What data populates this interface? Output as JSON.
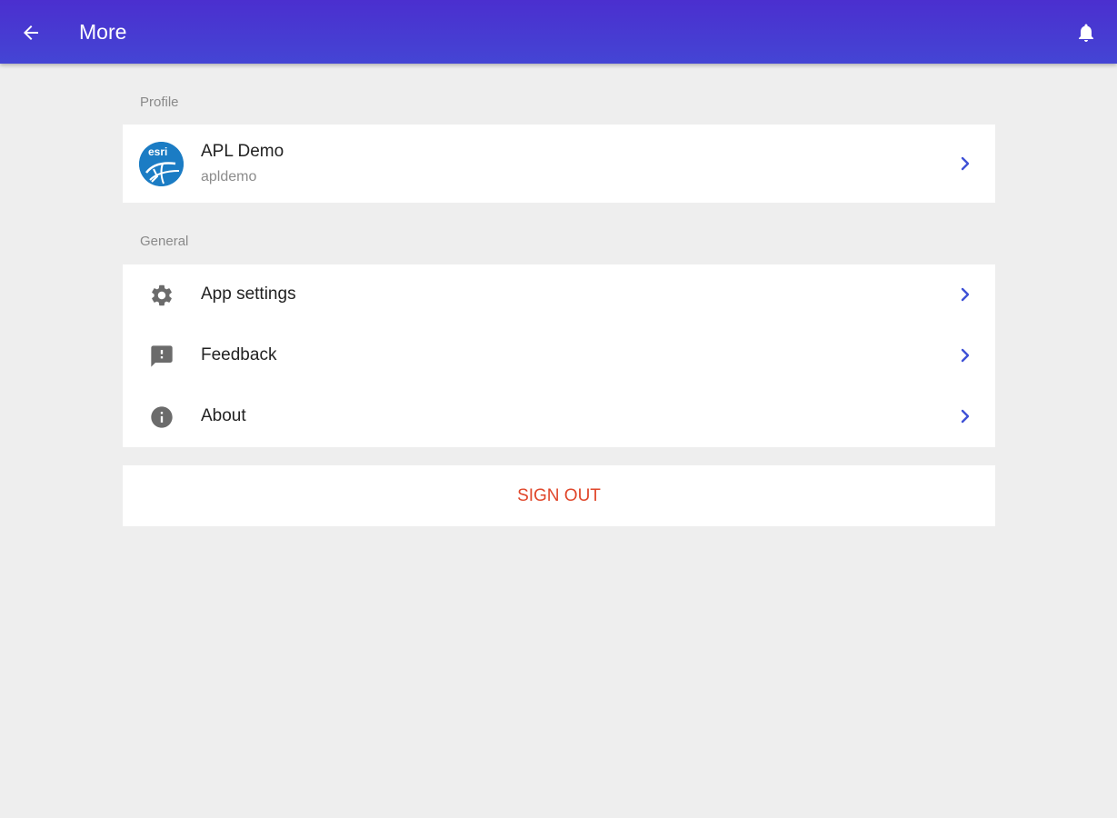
{
  "header": {
    "title": "More",
    "back_icon": "arrow-back-icon",
    "notification_icon": "bell-icon"
  },
  "profile": {
    "section_label": "Profile",
    "name": "APL Demo",
    "username": "apldemo",
    "avatar_text": "esri"
  },
  "general": {
    "section_label": "General",
    "items": [
      {
        "label": "App settings",
        "icon": "gear-icon"
      },
      {
        "label": "Feedback",
        "icon": "feedback-icon"
      },
      {
        "label": "About",
        "icon": "info-icon"
      }
    ]
  },
  "sign_out_label": "SIGN OUT",
  "colors": {
    "header_start": "#4b2fcf",
    "header_end": "#4445d4",
    "chevron": "#3f51d6",
    "sign_out": "#e0472b",
    "background": "#eeeeee"
  }
}
